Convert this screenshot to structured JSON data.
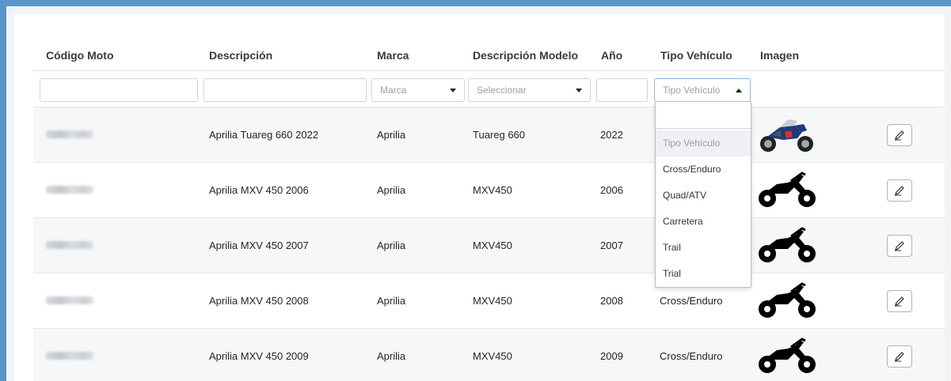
{
  "table": {
    "headers": [
      "Código Moto",
      "Descripción",
      "Marca",
      "Descripción Modelo",
      "Año",
      "Tipo Vehículo",
      "Imagen"
    ],
    "filters": {
      "marca_placeholder": "Marca",
      "modelo_placeholder": "Seleccionar",
      "tipo_placeholder": "Tipo Vehículo"
    },
    "rows": [
      {
        "descripcion": "Aprilia Tuareg 660 2022",
        "marca": "Aprilia",
        "modelo": "Tuareg 660",
        "anio": "2022",
        "tipo": "",
        "image": "adventure-bike-photo"
      },
      {
        "descripcion": "Aprilia MXV 450 2006",
        "marca": "Aprilia",
        "modelo": "MXV450",
        "anio": "2006",
        "tipo": "",
        "image": "dirt-bike-silhouette"
      },
      {
        "descripcion": "Aprilia MXV 450 2007",
        "marca": "Aprilia",
        "modelo": "MXV450",
        "anio": "2007",
        "tipo": "",
        "image": "dirt-bike-silhouette"
      },
      {
        "descripcion": "Aprilia MXV 450 2008",
        "marca": "Aprilia",
        "modelo": "MXV450",
        "anio": "2008",
        "tipo": "Cross/Enduro",
        "image": "dirt-bike-silhouette"
      },
      {
        "descripcion": "Aprilia MXV 450 2009",
        "marca": "Aprilia",
        "modelo": "MXV450",
        "anio": "2009",
        "tipo": "Cross/Enduro",
        "image": "dirt-bike-silhouette"
      }
    ]
  },
  "dropdown": {
    "options": [
      "Tipo Vehículo",
      "Cross/Enduro",
      "Quad/ATV",
      "Carretera",
      "Trail",
      "Trial"
    ]
  },
  "icons": {
    "edit": "pencil-icon"
  }
}
